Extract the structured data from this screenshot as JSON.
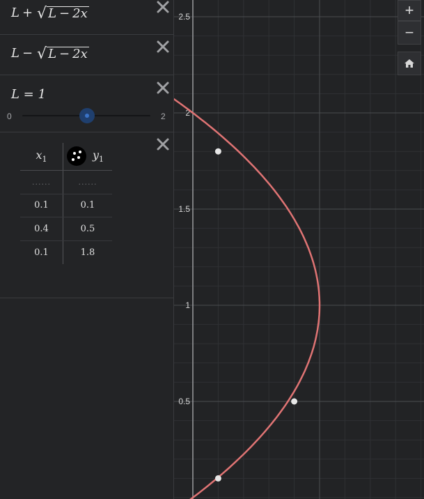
{
  "expressions": [
    {
      "id": 1,
      "lhs": "L",
      "op": "+",
      "radicand_var": "L",
      "radicand_op": "−",
      "radicand_term": "2x"
    },
    {
      "id": 2,
      "lhs": "L",
      "op": "−",
      "radicand_var": "L",
      "radicand_op": "−",
      "radicand_term": "2x"
    }
  ],
  "slider": {
    "label": "L = 1",
    "value": 1,
    "min_label": "0",
    "max_label": "2",
    "min": 0,
    "max": 2
  },
  "table": {
    "col1_header": "x",
    "col1_sub": "1",
    "col2_header": "y",
    "col2_sub": "1",
    "placeholder_row": [
      "......",
      "......"
    ],
    "rows": [
      {
        "x": "0.1",
        "y": "0.1"
      },
      {
        "x": "0.4",
        "y": "0.5"
      },
      {
        "x": "0.1",
        "y": "1.8"
      }
    ]
  },
  "graph": {
    "y_ticks": [
      "2.5",
      "2",
      "1.5",
      "1",
      "0.5"
    ],
    "curve_color": "#e07474",
    "point_color": "#e6e6e6",
    "background": "#222325"
  },
  "zoom_controls": {
    "zoom_in_label": "+",
    "zoom_out_label": "−",
    "home_icon": "home-icon"
  }
}
